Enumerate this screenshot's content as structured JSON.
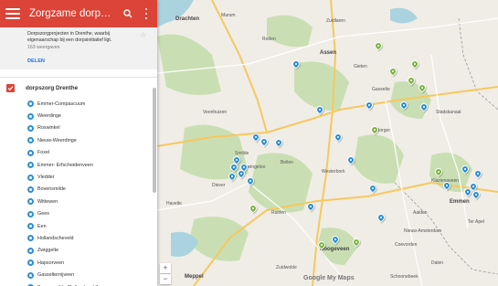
{
  "sidebar": {
    "title": "Zorgzame dorpen Dren...",
    "description": "Dorpszorgprojecten in Drenthe, waarbij eigenaarschap bij een dorpsinitiatief ligt.",
    "views": "163 weergaven",
    "share_label": "DELEN",
    "layer_name": "dorpszorg Drenthe",
    "places": [
      "Emmer-Compascuum",
      "Weerdinge",
      "Roswinkel",
      "Nieuw-Weerdinge",
      "Foxel",
      "Emmer- Erfscheidenveen",
      "Vledder",
      "Bovensmilde",
      "Wittewen",
      "Gees",
      "Een",
      "Hollandscheveld",
      "Zwiggelte",
      "Hapsorveen",
      "Gasselternijveen",
      "Bovensmilde (Bollandsveld)"
    ]
  },
  "map": {
    "attribution": "Google My Maps",
    "zoom_in_label": "+",
    "zoom_out_label": "−",
    "marker_colors": {
      "blue": "#2c8fd4",
      "green": "#7cb342"
    },
    "cities": [
      "Assen",
      "Emmen",
      "Hoogeveen",
      "Drachten",
      "Meppel"
    ],
    "towns": [
      "Marum",
      "Roden",
      "Veenhuizen",
      "Smilde",
      "Beilen",
      "Westerbork",
      "Gieten",
      "Borger",
      "Stadskanaal",
      "Ter Apel",
      "Coevorden",
      "Dalen",
      "Havelte",
      "Diever",
      "Dwingeloo",
      "Ruinen",
      "Zuidwolde",
      "Aalden",
      "Klazienaveen",
      "Schoonebeek",
      "Zuidlaren",
      "Gasselte",
      "Nieuw-Amsterdam"
    ]
  }
}
